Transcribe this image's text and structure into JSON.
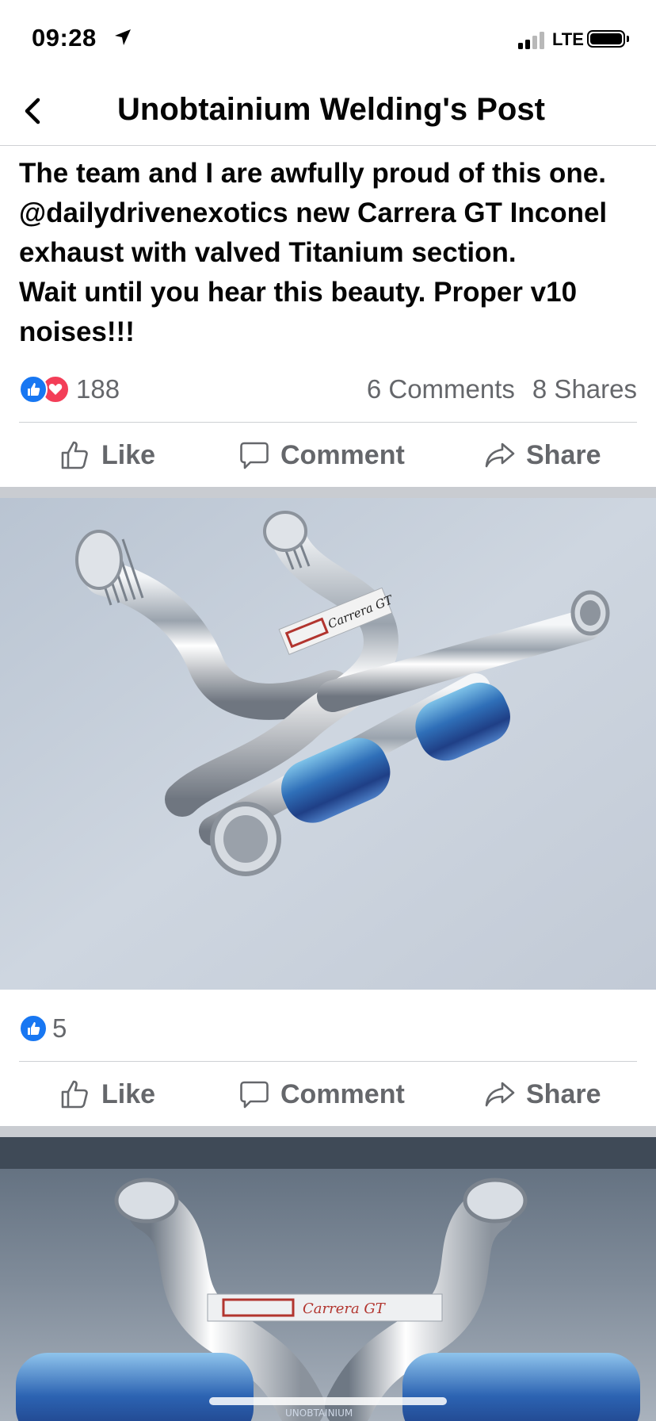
{
  "status_bar": {
    "time": "09:28",
    "carrier": "LTE"
  },
  "header": {
    "title": "Unobtainium Welding's Post",
    "back_icon": "chevron-left-icon"
  },
  "post": {
    "text_lines": [
      "The team and I are awfully proud of this one. @dailydrivenexotics new Carrera GT Inconel exhaust with valved Titanium section.",
      "Wait until you hear this beauty. Proper v10 noises!!!"
    ],
    "reaction_count": "188",
    "comments": "6 Comments",
    "shares": "8 Shares"
  },
  "actions": {
    "like": "Like",
    "comment": "Comment",
    "share": "Share"
  },
  "photos": [
    {
      "label_brand": "Carrera GT",
      "reaction_count": "5"
    },
    {
      "label_brand": "Carrera GT",
      "plaque_text": "UNOBTAINIUM"
    }
  ],
  "colors": {
    "facebook_blue": "#1877f2",
    "love_red": "#f33e58",
    "secondary_text": "#65676b"
  }
}
